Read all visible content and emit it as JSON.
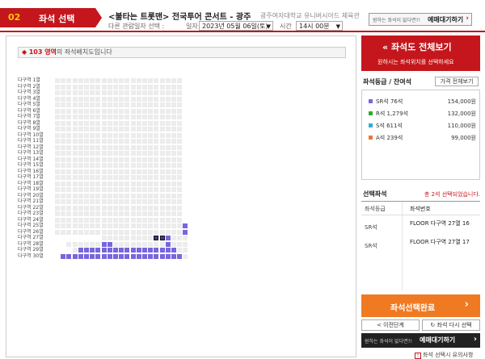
{
  "header": {
    "step_num": "02",
    "step_label": "좌석 선택",
    "show_title": "<불타는 트롯맨> 전국투어 콘서트 - 광주",
    "venue": "광주여자대학교 유니버시아드 체육관",
    "select_label": "다른 관람일자 선택 :",
    "date_label": "일자",
    "date_value": "2023년 05월 06일(토)",
    "time_label": "시간",
    "time_value": "14시 00분",
    "wait_small": "원하는 좌석이 없다면?!",
    "wait_big": "예매대기하기"
  },
  "map": {
    "area_notice_zone": "103 영역",
    "area_notice_text": "의 좌석배치도입니다",
    "row_labels": [
      "다구역 1열",
      "다구역 2열",
      "다구역 3열",
      "다구역 4열",
      "다구역 5열",
      "다구역 6열",
      "다구역 7열",
      "다구역 8열",
      "다구역 9열",
      "다구역 10열",
      "다구역 11열",
      "다구역 12열",
      "다구역 13열",
      "다구역 14열",
      "다구역 15열",
      "다구역 16열",
      "다구역 17열",
      "다구역 18열",
      "다구역 19열",
      "다구역 20열",
      "다구역 21열",
      "다구역 22열",
      "다구역 23열",
      "다구역 24열",
      "다구역 25열",
      "다구역 26열",
      "다구역 27열",
      "다구역 28열",
      "다구역 29열",
      "다구역 30열"
    ]
  },
  "panel": {
    "all_view_title": "좌석도 전체보기",
    "all_view_sub": "원하시는 좌석위치를 선택하세요",
    "grade_title": "좌석등급 / 잔여석",
    "price_btn": "가격 전체보기",
    "grades": [
      {
        "name": "SR석 76석",
        "price": "154,000원",
        "color": "#7766dd"
      },
      {
        "name": "R석 1,279석",
        "price": "132,000원",
        "color": "#33aa33"
      },
      {
        "name": "S석 611석",
        "price": "110,000원",
        "color": "#33aadd"
      },
      {
        "name": "A석 239석",
        "price": "99,000원",
        "color": "#ee7733"
      }
    ],
    "selected_title": "선택좌석",
    "selected_msg": "총 2석 선택되었습니다.",
    "col_grade": "좌석등급",
    "col_seat": "좌석번호",
    "selected": [
      {
        "grade": "SR석",
        "seat": "FLOOR 다구역 27열 16"
      },
      {
        "grade": "SR석",
        "seat": "FLOOR 다구역 27열 17"
      }
    ],
    "done_btn": "좌석선택완료",
    "prev_btn": "< 이전단계",
    "reset_btn": "좌석 다시 선택",
    "wait_small": "원하는 좌석이 없다면?!",
    "wait_big": "예매대기하기",
    "guide": "좌석 선택시 유의사항"
  }
}
